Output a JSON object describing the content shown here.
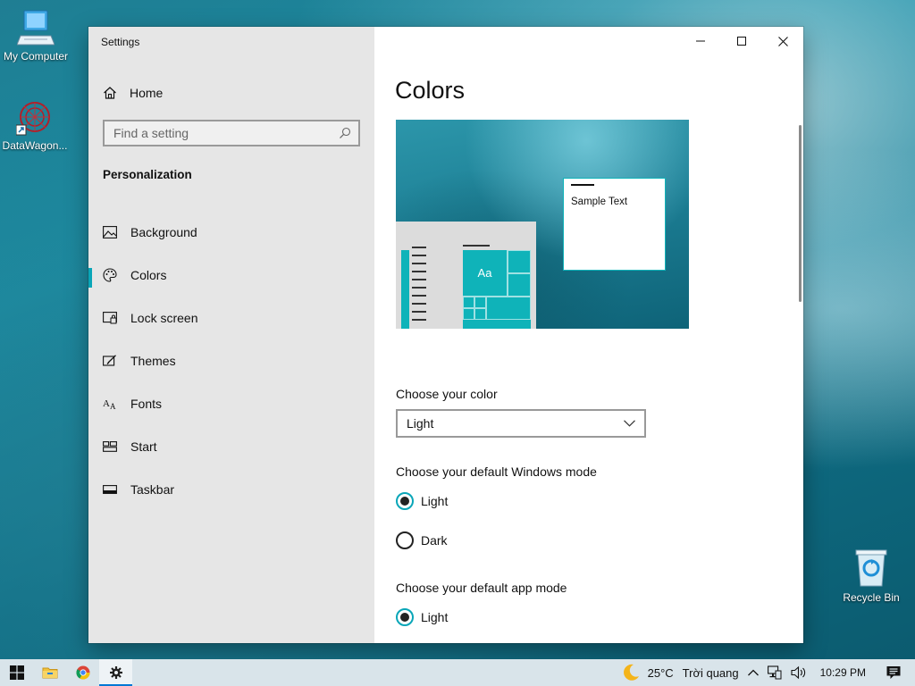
{
  "desktop": {
    "icons": [
      {
        "label": "My Computer",
        "icon": "computer-icon"
      },
      {
        "label": "DataWagon...",
        "icon": "datawagon-icon"
      },
      {
        "label": "Recycle Bin",
        "icon": "recycle-bin-icon"
      }
    ]
  },
  "window": {
    "title": "Settings",
    "buttons": {
      "minimize": "minimize-icon",
      "maximize": "maximize-icon",
      "close": "close-icon"
    }
  },
  "sidebar": {
    "home_label": "Home",
    "search_placeholder": "Find a setting",
    "section": "Personalization",
    "items": [
      {
        "label": "Background",
        "icon": "image-icon"
      },
      {
        "label": "Colors",
        "icon": "palette-icon",
        "active": true
      },
      {
        "label": "Lock screen",
        "icon": "lock-screen-icon"
      },
      {
        "label": "Themes",
        "icon": "themes-icon"
      },
      {
        "label": "Fonts",
        "icon": "fonts-icon"
      },
      {
        "label": "Start",
        "icon": "start-icon"
      },
      {
        "label": "Taskbar",
        "icon": "taskbar-icon"
      }
    ]
  },
  "main": {
    "title": "Colors",
    "preview": {
      "sample_text": "Sample Text",
      "tile_text": "Aa"
    },
    "choose_color_label": "Choose your color",
    "choose_color_value": "Light",
    "windows_mode_label": "Choose your default Windows mode",
    "windows_mode_options": [
      {
        "label": "Light",
        "checked": true
      },
      {
        "label": "Dark",
        "checked": false
      }
    ],
    "app_mode_label": "Choose your default app mode",
    "app_mode_options": [
      {
        "label": "Light",
        "checked": true
      }
    ]
  },
  "taskbar": {
    "weather_temp": "25°C",
    "weather_desc": "Trời quang",
    "time": "10:29 PM"
  },
  "colors": {
    "accent": "#0aa6b8",
    "tile": "#0fb3b9"
  }
}
